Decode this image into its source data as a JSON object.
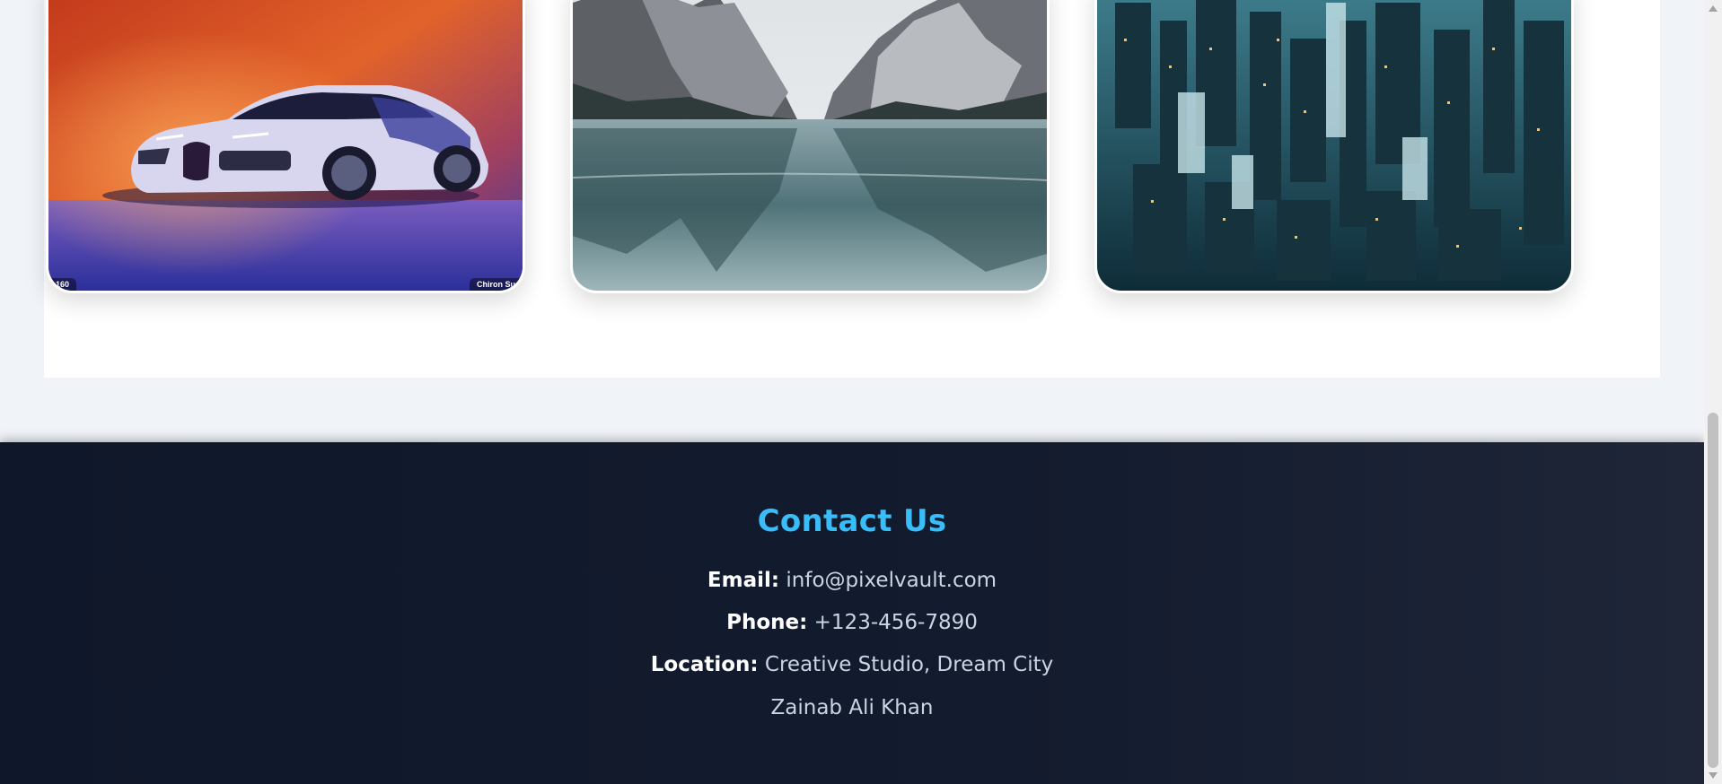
{
  "gallery": {
    "cards": [
      {
        "id": "car",
        "caption_left": "160",
        "caption_right": "Chiron Su"
      },
      {
        "id": "lake"
      },
      {
        "id": "city"
      }
    ]
  },
  "footer": {
    "title": "Contact Us",
    "email_label": "Email:",
    "email_value": "info@pixelvault.com",
    "phone_label": "Phone:",
    "phone_value": "+123-456-7890",
    "location_label": "Location:",
    "location_value": "Creative Studio, Dream City",
    "author": "Zainab Ali Khan"
  },
  "colors": {
    "accent": "#38bdf8",
    "footer_bg": "#0f172a",
    "page_bg": "#f0f4f9"
  }
}
